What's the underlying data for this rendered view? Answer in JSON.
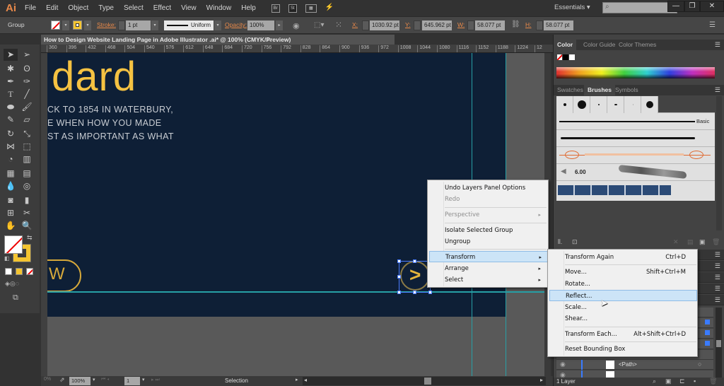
{
  "app": {
    "logo": "Ai",
    "menu": [
      "File",
      "Edit",
      "Object",
      "Type",
      "Select",
      "Effect",
      "View",
      "Window",
      "Help"
    ],
    "menubar_icons": [
      "Br",
      "St",
      "arrange-documents-icon",
      "gpu-performance-icon"
    ],
    "workspace": "Essentials ▾",
    "search_placeholder": "",
    "window_buttons": [
      "—",
      "❐",
      "✕"
    ]
  },
  "control_bar": {
    "selection_type": "Group",
    "stroke_label": "Stroke:",
    "stroke_weight": "1 pt",
    "stroke_profile": "Uniform",
    "opacity_label": "Opacity:",
    "opacity": "100%",
    "x_label": "X:",
    "x": "1030.92 pt",
    "y_label": "Y:",
    "y": "645.962 pt",
    "w_label": "W:",
    "w": "58.077 pt",
    "h_label": "H:",
    "h": "58.077 pt"
  },
  "document": {
    "tab_title": "How to Design Website Landing Page in Adobe Illustrator .ai* @ 100% (CMYK/Preview)",
    "tab_close": "×",
    "ruler_ticks": [
      "360",
      "396",
      "432",
      "468",
      "504",
      "540",
      "576",
      "612",
      "648",
      "684",
      "720",
      "756",
      "792",
      "828",
      "864",
      "900",
      "936",
      "972",
      "1008",
      "1044",
      "1080",
      "1116",
      "1152",
      "1188",
      "1224",
      "12"
    ]
  },
  "artwork": {
    "headline": "dard",
    "body_lines": [
      "CK TO 1854 IN WATERBURY,",
      "E WHEN HOW YOU MADE",
      "ST AS IMPORTANT AS WHAT"
    ],
    "pill_label": "W",
    "circle_glyph": ">",
    "colors": {
      "artboard": "#0e1f36",
      "gold": "#f5c242",
      "guide": "#27a0a6"
    }
  },
  "context_menu": {
    "items": [
      {
        "label": "Undo Layers Panel Options",
        "disabled": false
      },
      {
        "label": "Redo",
        "disabled": true
      },
      {
        "label": "Perspective",
        "disabled": true,
        "submenu": true
      },
      {
        "label": "Isolate Selected Group",
        "disabled": false
      },
      {
        "label": "Ungroup",
        "disabled": false
      },
      {
        "label": "Transform",
        "disabled": false,
        "submenu": true,
        "highlighted": true
      },
      {
        "label": "Arrange",
        "disabled": false,
        "submenu": true
      },
      {
        "label": "Select",
        "disabled": false,
        "submenu": true
      }
    ]
  },
  "transform_submenu": {
    "items": [
      {
        "label": "Transform Again",
        "shortcut": "Ctrl+D"
      },
      {
        "label": "Move...",
        "shortcut": "Shift+Ctrl+M"
      },
      {
        "label": "Rotate...",
        "shortcut": ""
      },
      {
        "label": "Reflect...",
        "shortcut": "",
        "highlighted": true
      },
      {
        "label": "Scale...",
        "shortcut": ""
      },
      {
        "label": "Shear...",
        "shortcut": ""
      },
      {
        "label": "Transform Each...",
        "shortcut": "Alt+Shift+Ctrl+D"
      },
      {
        "label": "Reset Bounding Box",
        "shortcut": ""
      }
    ]
  },
  "panels": {
    "color_tabs": [
      "Color",
      "Color Guide",
      "Color Themes"
    ],
    "brush_tabs": [
      "Swatches",
      "Brushes",
      "Symbols"
    ],
    "brush_basic_label": "Basic",
    "brush_size": "6.00",
    "layers": {
      "rows": [
        "<Path>",
        "<Path>"
      ],
      "footer": "1 Layer"
    }
  },
  "status_bar": {
    "zoom": "100%",
    "artboard_num": "1",
    "tool": "Selection"
  }
}
